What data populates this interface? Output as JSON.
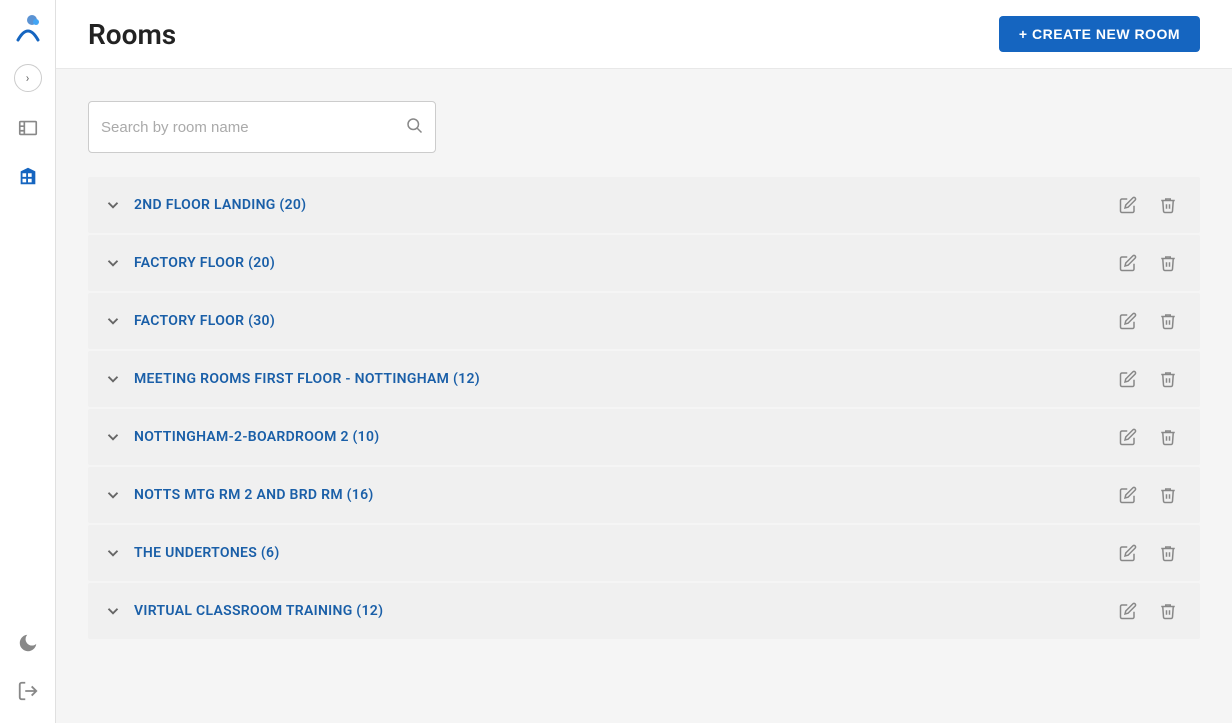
{
  "header": {
    "title": "Rooms",
    "create_button_label": "+ CREATE NEW ROOM"
  },
  "search": {
    "placeholder": "Search by room name"
  },
  "rooms": [
    {
      "id": 1,
      "name": "2ND FLOOR LANDING (20)"
    },
    {
      "id": 2,
      "name": "FACTORY FLOOR (20)"
    },
    {
      "id": 3,
      "name": "FACTORY FLOOR (30)"
    },
    {
      "id": 4,
      "name": "MEETING ROOMS FIRST FLOOR - NOTTINGHAM (12)"
    },
    {
      "id": 5,
      "name": "NOTTINGHAM-2-BOARDROOM 2 (10)"
    },
    {
      "id": 6,
      "name": "NOTTS MTG RM 2 AND BRD RM (16)"
    },
    {
      "id": 7,
      "name": "THE UNDERTONES (6)"
    },
    {
      "id": 8,
      "name": "VIRTUAL CLASSROOM TRAINING (12)"
    }
  ],
  "sidebar": {
    "toggle_label": "›"
  }
}
